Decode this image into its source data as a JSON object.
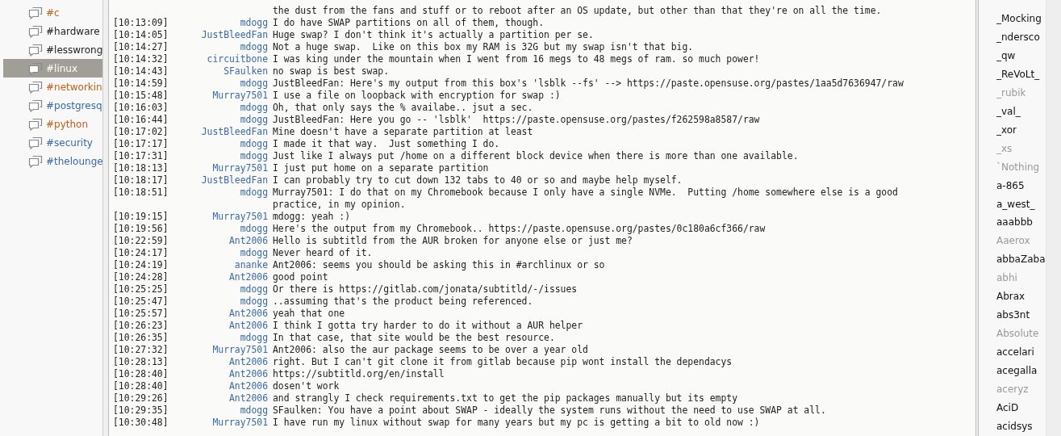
{
  "channels": [
    {
      "name": "#c",
      "color": "#c0601a",
      "selected": false
    },
    {
      "name": "#hardware",
      "color": "#222222",
      "selected": false
    },
    {
      "name": "#lesswrong",
      "color": "#222222",
      "selected": false
    },
    {
      "name": "#linux",
      "color": "#ffffff",
      "selected": true
    },
    {
      "name": "#networkin",
      "color": "#c0601a",
      "selected": false
    },
    {
      "name": "#postgresq",
      "color": "#3a6aa8",
      "selected": false
    },
    {
      "name": "#python",
      "color": "#c0601a",
      "selected": false
    },
    {
      "name": "#security",
      "color": "#3a6aa8",
      "selected": false
    },
    {
      "name": "#thelounge",
      "color": "#3a6aa8",
      "selected": false
    }
  ],
  "messages": [
    {
      "lines": [
        "the dust from the fans and stuff or to reboot after an OS update, but other than that they're on all the time."
      ]
    },
    {
      "time": "[10:13:09]",
      "nick": "mdogg",
      "lines": [
        "I do have SWAP partitions on all of them, though."
      ]
    },
    {
      "time": "[10:14:05]",
      "nick": "JustBleedFan",
      "lines": [
        "Huge swap? I don't think it's actually a partition per se."
      ]
    },
    {
      "time": "[10:14:27]",
      "nick": "mdogg",
      "lines": [
        "Not a huge swap.  Like on this box my RAM is 32G but my swap isn't that big."
      ]
    },
    {
      "time": "[10:14:32]",
      "nick": "circuitbone",
      "lines": [
        "I was king under the mountain when I went from 16 megs to 48 megs of ram. so much power!"
      ]
    },
    {
      "time": "[10:14:43]",
      "nick": "SFaulken",
      "lines": [
        "no swap is best swap."
      ]
    },
    {
      "time": "[10:14:59]",
      "nick": "mdogg",
      "lines": [
        "JustBleedFan: Here's my output from this box's 'lsblk --fs' --> https://paste.opensuse.org/pastes/1aa5d7636947/raw"
      ]
    },
    {
      "time": "[10:15:48]",
      "nick": "Murray7501",
      "lines": [
        "I use a file on loopback with encryption for swap :)"
      ]
    },
    {
      "time": "[10:16:03]",
      "nick": "mdogg",
      "lines": [
        "Oh, that only says the % availabe.. jsut a sec."
      ]
    },
    {
      "time": "[10:16:44]",
      "nick": "mdogg",
      "lines": [
        "JustBleedFan: Here you go -- 'lsblk'  https://paste.opensuse.org/pastes/f262598a8587/raw"
      ]
    },
    {
      "time": "[10:17:02]",
      "nick": "JustBleedFan",
      "lines": [
        "Mine doesn't have a separate partition at least"
      ]
    },
    {
      "time": "[10:17:17]",
      "nick": "mdogg",
      "lines": [
        "I made it that way.  Just something I do."
      ]
    },
    {
      "time": "[10:17:31]",
      "nick": "mdogg",
      "lines": [
        "Just like I always put /home on a different block device when there is more than one available."
      ]
    },
    {
      "time": "[10:18:13]",
      "nick": "Murray7501",
      "lines": [
        "I just put home on a separate partition"
      ]
    },
    {
      "time": "[10:18:17]",
      "nick": "JustBleedFan",
      "lines": [
        "I can probably try to cut down 132 tabs to 40 or so and maybe help myself."
      ]
    },
    {
      "time": "[10:18:51]",
      "nick": "mdogg",
      "lines": [
        "Murray7501: I do that on my Chromebook because I only have a single NVMe.  Putting /home somewhere else is a good",
        "practice, in my opinion."
      ]
    },
    {
      "time": "[10:19:15]",
      "nick": "Murray7501",
      "lines": [
        "mdogg: yeah :)"
      ]
    },
    {
      "time": "[10:19:56]",
      "nick": "mdogg",
      "lines": [
        "Here's the output from my Chromebook.. https://paste.opensuse.org/pastes/0c180a6cf366/raw"
      ]
    },
    {
      "time": "[10:22:59]",
      "nick": "Ant2006",
      "lines": [
        "Hello is subtitld from the AUR broken for anyone else or just me?"
      ]
    },
    {
      "time": "[10:24:17]",
      "nick": "mdogg",
      "lines": [
        "Never heard of it."
      ]
    },
    {
      "time": "[10:24:19]",
      "nick": "ananke",
      "lines": [
        "Ant2006: seems you should be asking this in #archlinux or so"
      ]
    },
    {
      "time": "[10:24:28]",
      "nick": "Ant2006",
      "lines": [
        "good point"
      ]
    },
    {
      "time": "[10:25:25]",
      "nick": "mdogg",
      "lines": [
        "Or there is https://gitlab.com/jonata/subtitld/-/issues"
      ]
    },
    {
      "time": "[10:25:47]",
      "nick": "mdogg",
      "lines": [
        "..assuming that's the product being referenced."
      ]
    },
    {
      "time": "[10:25:57]",
      "nick": "Ant2006",
      "lines": [
        "yeah that one"
      ]
    },
    {
      "time": "[10:26:23]",
      "nick": "Ant2006",
      "lines": [
        "I think I gotta try harder to do it without a AUR helper"
      ]
    },
    {
      "time": "[10:26:35]",
      "nick": "mdogg",
      "lines": [
        "In that case, that site would be the best resource."
      ]
    },
    {
      "time": "[10:27:32]",
      "nick": "Murray7501",
      "lines": [
        "Ant2006: also the aur package seems to be over a year old"
      ]
    },
    {
      "time": "[10:28:13]",
      "nick": "Ant2006",
      "lines": [
        "right. But I can't git clone it from gitlab because pip wont install the dependacys"
      ]
    },
    {
      "time": "[10:28:40]",
      "nick": "Ant2006",
      "lines": [
        "https://subtitld.org/en/install"
      ]
    },
    {
      "time": "[10:28:40]",
      "nick": "Ant2006",
      "lines": [
        "dosen't work"
      ]
    },
    {
      "time": "[10:29:26]",
      "nick": "Ant2006",
      "lines": [
        "and strangly I check requirements.txt to get the pip packages manually but its empty"
      ]
    },
    {
      "time": "[10:29:35]",
      "nick": "mdogg",
      "lines": [
        "SFaulken: You have a point about SWAP - ideally the system runs without the need to use SWAP at all."
      ]
    },
    {
      "time": "[10:30:48]",
      "nick": "Murray7501",
      "lines": [
        "I have run my linux without swap for many years but my pc is getting a bit to old now :)"
      ]
    }
  ],
  "users": [
    {
      "name": "_Mocking",
      "away": false
    },
    {
      "name": "_ndersco",
      "away": false
    },
    {
      "name": "_qw",
      "away": false
    },
    {
      "name": "_ReVoLt_",
      "away": false
    },
    {
      "name": "_rubik",
      "away": true
    },
    {
      "name": "_val_",
      "away": false
    },
    {
      "name": "_xor",
      "away": false
    },
    {
      "name": "_xs",
      "away": true
    },
    {
      "name": "`Nothing",
      "away": true
    },
    {
      "name": "a-865",
      "away": false
    },
    {
      "name": "a_west_",
      "away": false
    },
    {
      "name": "aaabbb",
      "away": false
    },
    {
      "name": "Aaerox",
      "away": true
    },
    {
      "name": "abbaZaba",
      "away": false
    },
    {
      "name": "abhi",
      "away": true
    },
    {
      "name": "Abrax",
      "away": false
    },
    {
      "name": "abs3nt",
      "away": false
    },
    {
      "name": "Absolute",
      "away": true
    },
    {
      "name": "accelari",
      "away": false
    },
    {
      "name": "acegalla",
      "away": false
    },
    {
      "name": "aceryz",
      "away": true
    },
    {
      "name": "AciD",
      "away": false
    },
    {
      "name": "acidsys",
      "away": false
    }
  ]
}
